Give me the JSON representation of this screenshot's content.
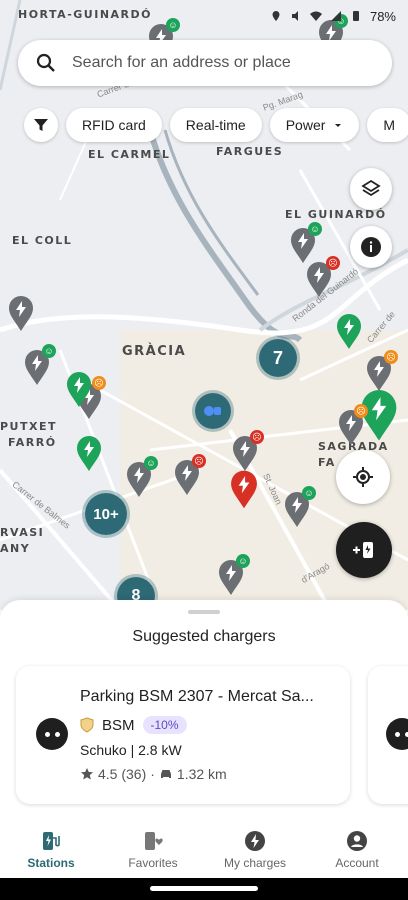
{
  "status_bar": {
    "time": "",
    "battery": "78%"
  },
  "search": {
    "placeholder": "Search for an address or place"
  },
  "filters": {
    "chips": [
      "RFID card",
      "Real-time",
      "Power",
      "M"
    ]
  },
  "map": {
    "labels": [
      "HORTA-GUINARDÓ",
      "EL CARMEL",
      "FARGUES",
      "EL GUINARDÓ",
      "EL COLL",
      "GRÀCIA",
      "PUTXET",
      "FARRÓ",
      "SAGRADA",
      "FA",
      "RVASI",
      "ANY"
    ],
    "streets": [
      "Ronda del Guinardó",
      "Carrer de",
      "Carrer de Balmes",
      "Pg. Marag",
      "St. Joan",
      "d'Aragó",
      "Carrer de L"
    ],
    "clusters": [
      "7",
      "10+",
      "8"
    ]
  },
  "sheet": {
    "title": "Suggested chargers",
    "card": {
      "name": "Parking BSM 2307 - Mercat Sa...",
      "operator": "BSM",
      "discount": "-10%",
      "plug_info": "Schuko | 2.8 kW",
      "rating": "4.5 (36)",
      "distance": "1.32 km"
    }
  },
  "nav": {
    "items": [
      {
        "label": "Stations",
        "icon": "ev-station-icon"
      },
      {
        "label": "Favorites",
        "icon": "favorites-icon"
      },
      {
        "label": "My charges",
        "icon": "bolt-icon"
      },
      {
        "label": "Account",
        "icon": "account-icon"
      }
    ]
  },
  "colors": {
    "primary": "#2e6a75",
    "green": "#1ea35a",
    "red": "#d93025",
    "gray_pin": "#6b6f74"
  }
}
